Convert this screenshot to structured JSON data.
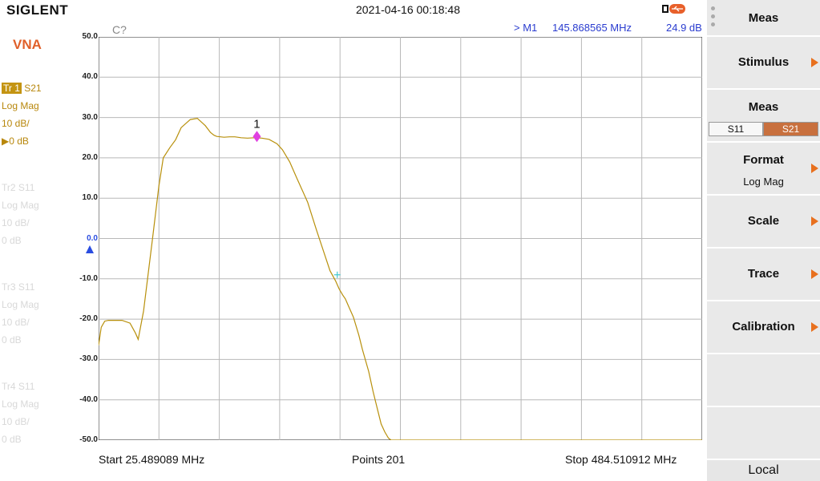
{
  "header": {
    "brand": "SIGLENT",
    "datetime": "2021-04-16 00:18:48",
    "usb_icon": "usb-icon"
  },
  "info": {
    "channel": "C?",
    "marker_name": "> M1",
    "marker_freq": "145.868565 MHz",
    "marker_value": "24.9 dB"
  },
  "left": {
    "mode": "VNA",
    "traces": [
      {
        "tag": "Tr 1",
        "param": "S21",
        "format": "Log Mag",
        "scale": "10 dB/",
        "ref": "▶0 dB"
      },
      {
        "tag": "Tr2",
        "param": "S11",
        "format": "Log Mag",
        "scale": "10 dB/",
        "ref": "0 dB"
      },
      {
        "tag": "Tr3",
        "param": "S11",
        "format": "Log Mag",
        "scale": "10 dB/",
        "ref": "0 dB"
      },
      {
        "tag": "Tr4",
        "param": "S11",
        "format": "Log Mag",
        "scale": "10 dB/",
        "ref": "0 dB"
      }
    ]
  },
  "chart_data": {
    "type": "line",
    "ylim": [
      -50,
      50
    ],
    "xlim": [
      25.489089,
      484.510912
    ],
    "y_ticks": [
      "50.0",
      "40.0",
      "30.0",
      "20.0",
      "10.0",
      "0.0",
      "-10.0",
      "-20.0",
      "-30.0",
      "-40.0",
      "-50.0"
    ],
    "grid": true,
    "reference_level": 0,
    "series": [
      {
        "color": "#b8900c",
        "x": [
          25.49,
          27.5,
          30.2,
          33.0,
          37.1,
          43.3,
          49.4,
          53.6,
          55.6,
          59.7,
          66.5,
          71.3,
          74.7,
          79.6,
          84.1,
          88.3,
          95.2,
          100.6,
          106.6,
          110.6,
          113.3,
          115.4,
          118.2,
          120.9,
          125.0,
          129.1,
          133.9,
          138.7,
          144.1,
          149.6,
          155.1,
          161.2,
          165.3,
          170.8,
          176.2,
          184.5,
          191.3,
          197.4,
          201.5,
          205.7,
          208.4,
          211.1,
          213.2,
          215.2,
          219.3,
          223.4,
          226.1,
          230.9,
          234.3,
          237.7,
          240.4,
          243.2,
          245.9,
          247.9,
          252.0,
          484.5
        ],
        "y": [
          -26.5,
          -22.0,
          -20.5,
          -20.3,
          -20.3,
          -20.3,
          -21.0,
          -23.5,
          -25.0,
          -18.0,
          0.0,
          13.0,
          20.0,
          22.5,
          24.5,
          27.5,
          29.5,
          29.8,
          28.0,
          26.3,
          25.6,
          25.3,
          25.2,
          25.1,
          25.2,
          25.2,
          25.0,
          24.9,
          25.0,
          24.9,
          24.6,
          23.5,
          22.0,
          19.0,
          15.0,
          9.0,
          2.0,
          -4.0,
          -8.0,
          -10.5,
          -12.5,
          -14.0,
          -15.0,
          -16.5,
          -19.5,
          -24.0,
          -27.5,
          -33.0,
          -38.0,
          -42.5,
          -46.0,
          -48.0,
          -49.5,
          -50.0,
          -50.0,
          -50.0
        ]
      }
    ],
    "marker": {
      "label": "1",
      "x": 145.868565,
      "y": 24.9,
      "color": "#e040e0"
    },
    "cursor": {
      "x": 207.0,
      "y": -9.0,
      "color": "#40c8d0"
    }
  },
  "bottom": {
    "start": "Start  25.489089 MHz",
    "points": "Points  201",
    "stop": "Stop  484.510912 MHz"
  },
  "menu": {
    "title": "Meas",
    "stimulus": "Stimulus",
    "meas": "Meas",
    "s11": "S11",
    "s21": "S21",
    "format": "Format",
    "format_value": "Log Mag",
    "scale": "Scale",
    "trace": "Trace",
    "calibration": "Calibration",
    "local": "Local"
  }
}
